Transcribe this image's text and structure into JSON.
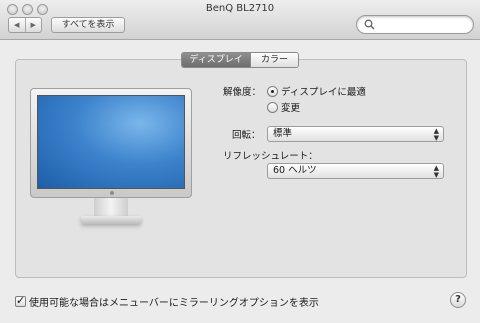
{
  "window": {
    "title": "BenQ BL2710",
    "show_all_label": "すべてを表示",
    "back_glyph": "◀",
    "forward_glyph": "▶",
    "search_placeholder": ""
  },
  "tabs": [
    {
      "label": "ディスプレイ",
      "active": true
    },
    {
      "label": "カラー",
      "active": false
    }
  ],
  "display": {
    "resolution_label": "解像度：",
    "resolution_options": [
      {
        "label": "ディスプレイに最適",
        "selected": true
      },
      {
        "label": "変更",
        "selected": false
      }
    ],
    "rotation_label": "回転：",
    "rotation_value": "標準",
    "refresh_label": "リフレッシュレート：",
    "refresh_value": "60 ヘルツ"
  },
  "footer": {
    "mirror_checkbox_label": "使用可能な場合はメニューバーにミラーリングオプションを表示",
    "mirror_checked": true,
    "help_label": "?"
  }
}
